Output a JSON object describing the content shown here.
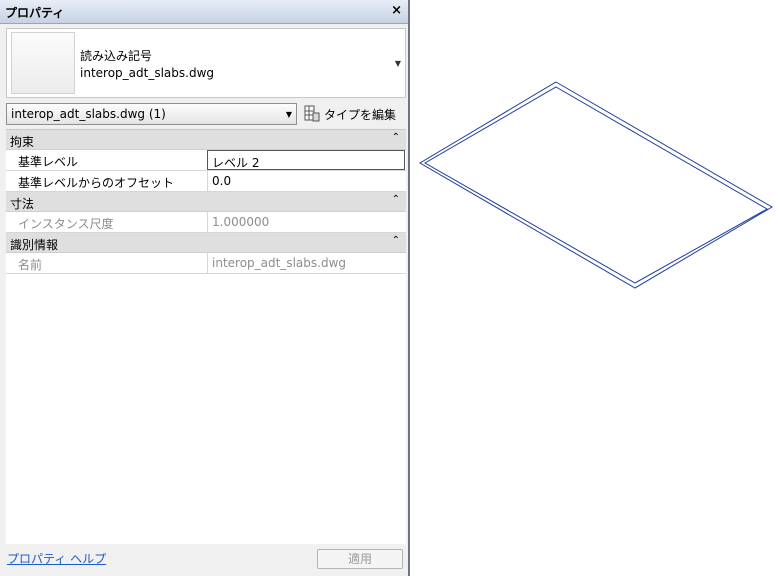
{
  "panel": {
    "title": "プロパティ",
    "close_label": "×"
  },
  "type_selector": {
    "family": "読み込み記号",
    "type_name": "interop_adt_slabs.dwg"
  },
  "instance_filter": {
    "value": "interop_adt_slabs.dwg (1)",
    "edit_type_label": "タイプを編集"
  },
  "groups": [
    {
      "label": "拘束",
      "rows": [
        {
          "name": "基準レベル",
          "value": "レベル 2"
        },
        {
          "name": "基準レベルからのオフセット",
          "value": "0.0"
        }
      ]
    },
    {
      "label": "寸法",
      "rows": [
        {
          "name": "インスタンス尺度",
          "value": "1.000000"
        }
      ]
    },
    {
      "label": "識別情報",
      "rows": [
        {
          "name": "名前",
          "value": "interop_adt_slabs.dwg"
        }
      ]
    }
  ],
  "footer": {
    "help_link": "プロパティ ヘルプ",
    "apply_label": "適用"
  },
  "viewport": {
    "shape": "slab-outline-isometric",
    "line_color": "#1f3f9a"
  }
}
